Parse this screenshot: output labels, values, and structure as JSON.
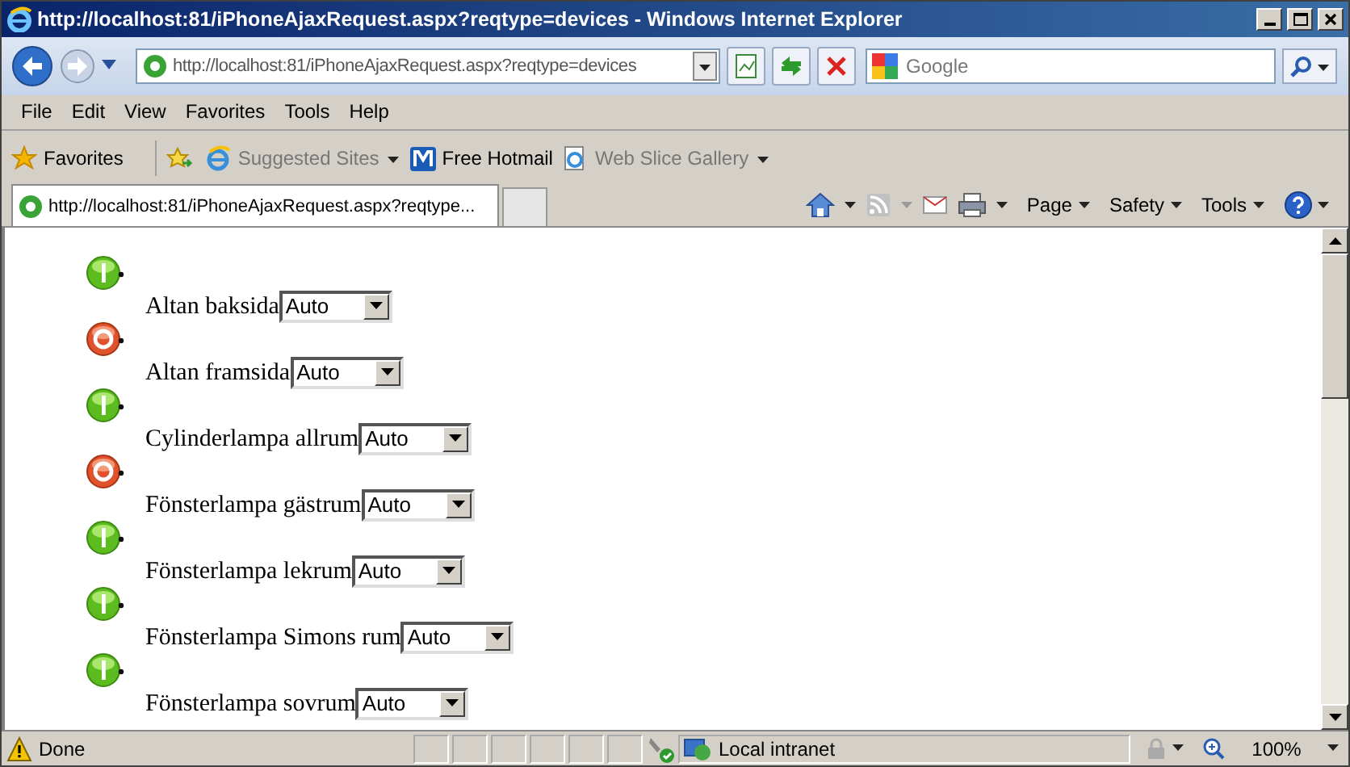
{
  "window": {
    "title": "http://localhost:81/iPhoneAjaxRequest.aspx?reqtype=devices - Windows Internet Explorer"
  },
  "address_bar": {
    "value": "http://localhost:81/iPhoneAjaxRequest.aspx?reqtype=devices"
  },
  "search": {
    "placeholder": "Google"
  },
  "menu": [
    "File",
    "Edit",
    "View",
    "Favorites",
    "Tools",
    "Help"
  ],
  "favorites_bar": [
    {
      "kind": "favorites",
      "label": "Favorites"
    },
    {
      "kind": "add"
    },
    {
      "kind": "suggested",
      "label": "Suggested Sites"
    },
    {
      "kind": "hotmail",
      "label": "Free Hotmail"
    },
    {
      "kind": "slice",
      "label": "Web Slice Gallery"
    }
  ],
  "tab": {
    "title": "http://localhost:81/iPhoneAjaxRequest.aspx?reqtype..."
  },
  "command_bar": [
    "Page",
    "Safety",
    "Tools"
  ],
  "devices": [
    {
      "name": "Altan baksida",
      "on": true,
      "mode": "Auto"
    },
    {
      "name": "Altan framsida",
      "on": false,
      "mode": "Auto"
    },
    {
      "name": "Cylinderlampa allrum",
      "on": true,
      "mode": "Auto"
    },
    {
      "name": "Fönsterlampa gästrum",
      "on": false,
      "mode": "Auto"
    },
    {
      "name": "Fönsterlampa lekrum",
      "on": true,
      "mode": "Auto"
    },
    {
      "name": "Fönsterlampa Simons rum",
      "on": true,
      "mode": "Auto"
    },
    {
      "name": "Fönsterlampa sovrum",
      "on": true,
      "mode": "Auto"
    }
  ],
  "status_bar": {
    "text": "Done",
    "zone": "Local intranet",
    "zoom": "100%"
  }
}
